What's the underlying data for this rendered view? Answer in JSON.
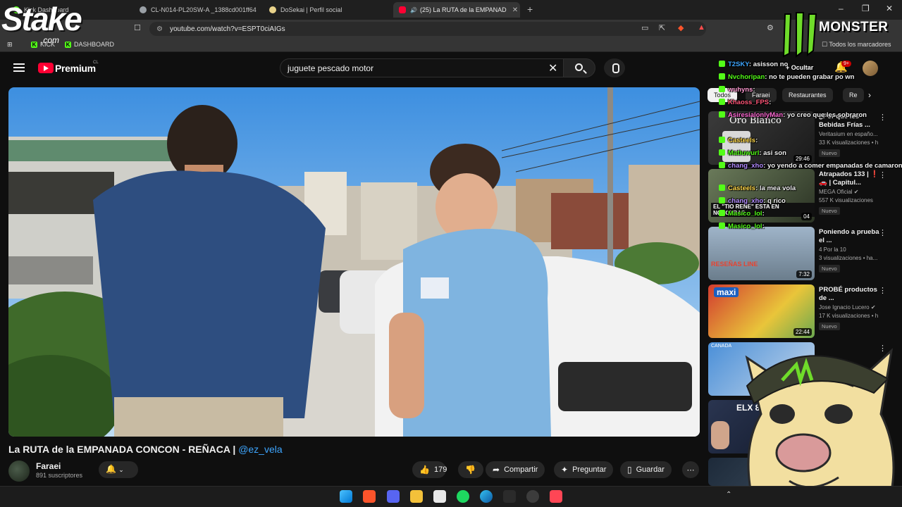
{
  "browser": {
    "tabs": [
      {
        "label": "Kick Dashboard",
        "color": "#53fc18"
      },
      {
        "label": "CL-N014-PL20SW-A _1388cd001ff64",
        "color": "#9aa0a6"
      },
      {
        "label": "DoSekai | Perfil social",
        "color": "#e8d28a"
      },
      {
        "label": "(25) La RUTA de la EMPANAD",
        "color": "#ff0033"
      }
    ],
    "url": "youtube.com/watch?v=ESPT0ciAIGs",
    "bookmarks": [
      "KICK",
      "DASHBOARD"
    ],
    "all_bookmarks": "Todos los marcadores",
    "window_controls": [
      "–",
      "❐",
      "✕"
    ]
  },
  "overlay": {
    "stake_logo": "Stake",
    "stake_com": ".com",
    "monster_text": "MONSTER"
  },
  "youtube": {
    "premium": "Premium",
    "country": "CL",
    "search_value": "juguete pescado motor",
    "notification_count": "9+"
  },
  "video": {
    "title_main": "La RUTA de la EMPANADA CONCON - REÑACA | ",
    "title_mention": "@ez_vela",
    "channel": "Faraei",
    "subscribers": "891 suscriptores",
    "likes": "179",
    "share": "Compartir",
    "ask": "Preguntar",
    "save": "Guardar"
  },
  "sidebar": {
    "chips": [
      "Todos",
      "Faraei",
      "Restaurantes",
      "Re"
    ],
    "recommendations": [
      {
        "title": "¿Por qué les Bebidas Frías ...",
        "channel": "Veritasium en españo...",
        "views": "33 K visualizaciones • h",
        "badge": "Nuevo",
        "duration": "29:46",
        "thumb_text": "Oro Blanco"
      },
      {
        "title": "Atrapados 133 | ❗🚗 | Capitul...",
        "channel": "MEGA Oficial ✔",
        "views": "557 K visualizaciones",
        "badge": "Nuevo",
        "duration": "04",
        "thumb_text": "EL \"TIO RENE\" ESTA EN NOSOTRAS"
      },
      {
        "title": "Poniendo a prueba el ...",
        "channel": "4 Por la 10",
        "views": "3 visualizaciones • ha...",
        "badge": "Nuevo",
        "duration": "7:32",
        "thumb_text": "RESEÑAS LINE"
      },
      {
        "title": "PROBÉ productos de ...",
        "channel": "Jose Ignacio Lucero ✔",
        "views": "17 K visualizaciones • h",
        "badge": "Nuevo",
        "duration": "22:44",
        "thumb_text": "maxi"
      },
      {
        "title": "",
        "channel": "",
        "views": "",
        "badge": "",
        "duration": "",
        "thumb_text": "CANADA"
      },
      {
        "title": "",
        "channel": "",
        "views": "",
        "badge": "",
        "duration": "",
        "thumb_text": "ELX 8"
      },
      {
        "title": "",
        "channel": "",
        "views": "",
        "badge": "",
        "duration": "",
        "thumb_text": ""
      }
    ]
  },
  "chat": [
    {
      "user": "T2SKY",
      "text": ": asisson no",
      "color": "#3ea6ff"
    },
    {
      "user": "Nvchoripan",
      "text": ": no te pueden grabar po wn",
      "color": "#53fc18"
    },
    {
      "user": "wuhyns",
      "text": ":",
      "color": "#ff9bd2"
    },
    {
      "user": "Khaoss_FPS",
      "text": ":",
      "color": "#ff5577"
    },
    {
      "user": "AsiresialonlyMan",
      "text": ": yo creo que les sobraron",
      "color": "#ff6ad5"
    },
    {
      "user": "Casteels",
      "text": ":",
      "color": "#ffd84a"
    },
    {
      "user": "Matiuwurl",
      "text": ": asi son",
      "color": "#53fc18"
    },
    {
      "user": "chang_xho",
      "text": ": yo yendo a comer empanadas de camaron queso",
      "color": "#b38bff"
    },
    {
      "user": "Casteels",
      "text": ": la mea vola",
      "color": "#ffd84a"
    },
    {
      "user": "chang_xho",
      "text": ": q rico",
      "color": "#b38bff"
    },
    {
      "user": "Masico_lol",
      "text": ":",
      "color": "#53fc18"
    },
    {
      "user": "Masico_lol",
      "text": ":",
      "color": "#53fc18"
    }
  ],
  "chat_extra": "Ocultar",
  "taskbar": {
    "icons": [
      "windows-icon",
      "brave-icon",
      "discord-icon",
      "folder-icon",
      "media-icon",
      "spotify-icon",
      "edge-icon",
      "steam-icon",
      "obs-icon",
      "valorant-icon"
    ]
  }
}
